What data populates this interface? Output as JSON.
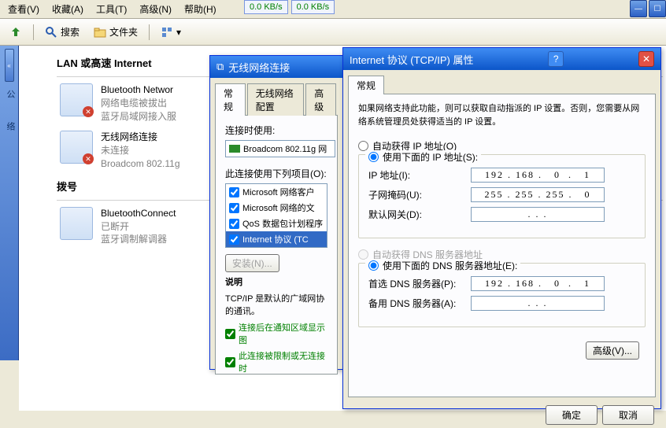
{
  "speed": {
    "down": "0.0 KB/s",
    "up": "0.0 KB/s"
  },
  "menu": {
    "view": "查看(V)",
    "fav": "收藏(A)",
    "tools": "工具(T)",
    "adv": "高级(N)",
    "help": "帮助(H)"
  },
  "toolbar": {
    "search": "搜索",
    "folders": "文件夹"
  },
  "sidebar": {
    "g1": "公",
    "g2": "络"
  },
  "sections": {
    "lan": "LAN 或高速 Internet",
    "dial": "拨号"
  },
  "conns": {
    "bt": {
      "name": "Bluetooth Networ",
      "l2": "网络电缆被拔出",
      "l3": "蓝牙局域网接入服"
    },
    "wifi": {
      "name": "无线网络连接",
      "l2": "未连接",
      "l3": "Broadcom 802.11g"
    },
    "btc": {
      "name": "BluetoothConnect",
      "l2": "已断开",
      "l3": "蓝牙调制解调器"
    }
  },
  "win1": {
    "title": "无线网络连接",
    "tabs": {
      "general": "常规",
      "wifi": "无线网络配置",
      "adv": "高级"
    },
    "useConn": "连接时使用:",
    "adapter": "Broadcom 802.11g 网",
    "itemsLbl": "此连接使用下列项目(O):",
    "items": [
      "Microsoft 网络客户",
      "Microsoft 网络的文",
      "QoS 数据包计划程序",
      "Internet 协议 (TC"
    ],
    "install": "安装(N)...",
    "desc": "说明",
    "descText": "TCP/IP 是默认的广域网协的通讯。",
    "chk1": "连接后在通知区域显示图",
    "chk2": "此连接被限制或无连接时"
  },
  "win2": {
    "title": "Internet 协议 (TCP/IP) 属性",
    "tab": "常规",
    "info": "如果网络支持此功能，则可以获取自动指派的 IP 设置。否则，您需要从网络系统管理员处获得适当的 IP 设置。",
    "autoIp": "自动获得 IP 地址(O)",
    "manualIp": "使用下面的 IP 地址(S):",
    "ipLbl": "IP 地址(I):",
    "ipVal": "192 . 168 .   0  .   1",
    "maskLbl": "子网掩码(U):",
    "maskVal": "255 . 255 . 255 .   0",
    "gwLbl": "默认网关(D):",
    "gwVal": ". . .",
    "autoDns": "自动获得 DNS 服务器地址",
    "manualDns": "使用下面的 DNS 服务器地址(E):",
    "dns1Lbl": "首选 DNS 服务器(P):",
    "dns1Val": "192 . 168 .   0  .   1",
    "dns2Lbl": "备用 DNS 服务器(A):",
    "dns2Val": ". . .",
    "adv": "高级(V)...",
    "ok": "确定",
    "cancel": "取消"
  }
}
